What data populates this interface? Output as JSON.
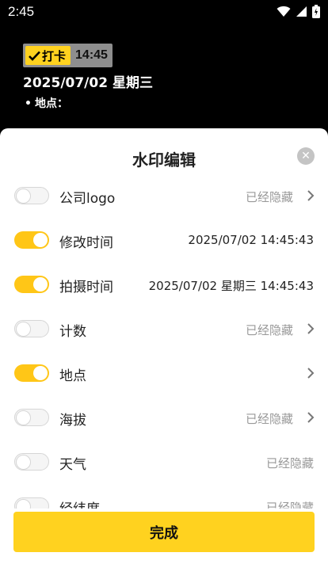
{
  "status_bar": {
    "time": "2:45",
    "icons": [
      "wifi-icon",
      "signal-icon",
      "battery-icon"
    ]
  },
  "watermark_preview": {
    "badge_label": "打卡",
    "badge_time": "14:45",
    "date_line": "2025/07/02 星期三",
    "location_label": "地点：",
    "bullet": "•"
  },
  "sheet": {
    "title": "水印编辑",
    "close_symbol": "✕",
    "rows": [
      {
        "label": "公司logo",
        "value": "已经隐藏",
        "enabled": false,
        "chevron": true,
        "value_style": "muted"
      },
      {
        "label": "修改时间",
        "value": "2025/07/02 14:45:43",
        "enabled": true,
        "chevron": false,
        "value_style": "dark"
      },
      {
        "label": "拍摄时间",
        "value": "2025/07/02 星期三 14:45:43",
        "enabled": true,
        "chevron": false,
        "value_style": "dark"
      },
      {
        "label": "计数",
        "value": "已经隐藏",
        "enabled": false,
        "chevron": true,
        "value_style": "muted"
      },
      {
        "label": "地点",
        "value": "",
        "enabled": true,
        "chevron": true,
        "value_style": "muted"
      },
      {
        "label": "海拔",
        "value": "已经隐藏",
        "enabled": false,
        "chevron": true,
        "value_style": "muted"
      },
      {
        "label": "天气",
        "value": "已经隐藏",
        "enabled": false,
        "chevron": false,
        "value_style": "muted"
      },
      {
        "label": "经纬度",
        "value": "已经隐藏",
        "enabled": false,
        "chevron": false,
        "value_style": "muted"
      }
    ],
    "done_label": "完成"
  },
  "colors": {
    "accent": "#ffd21f",
    "toggle_on": "#ffc617",
    "background_top": "#000000",
    "muted_text": "#999999"
  }
}
